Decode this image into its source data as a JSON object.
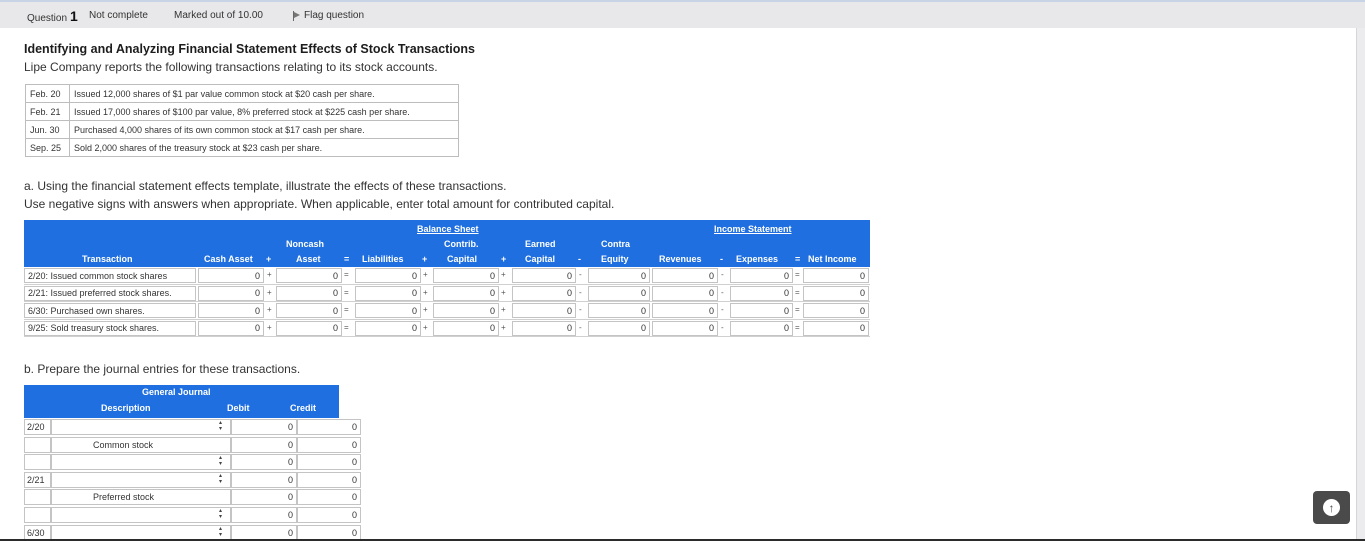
{
  "question_bar": {
    "label": "Question",
    "number": "1",
    "status": "Not complete",
    "marks": "Marked out of 10.00",
    "flag_label": "Flag question"
  },
  "title": "Identifying and Analyzing Financial Statement Effects of Stock Transactions",
  "intro": "Lipe Company reports the following transactions relating to its stock accounts.",
  "transactions": [
    {
      "date": "Feb. 20",
      "text": "Issued 12,000 shares of $1 par value common stock at $20 cash per share."
    },
    {
      "date": "Feb. 21",
      "text": "Issued 17,000 shares of $100 par value, 8% preferred stock at $225 cash per share."
    },
    {
      "date": "Jun. 30",
      "text": "Purchased 4,000 shares of its own common stock at $17 cash per share."
    },
    {
      "date": "Sep. 25",
      "text": "Sold 2,000 shares of the treasury stock at $23 cash per share."
    }
  ],
  "part_a": {
    "line1": "a. Using the financial statement effects template, illustrate the effects of these transactions.",
    "line2": "Use negative signs with answers when appropriate. When applicable, enter total amount for contributed capital."
  },
  "effects": {
    "group_balance": "Balance Sheet",
    "group_income": "Income Statement",
    "h_transaction": "Transaction",
    "h_cash": "Cash Asset",
    "h_noncash_1": "Noncash",
    "h_noncash_2": "Asset",
    "h_liabilities": "Liabilities",
    "h_contrib_1": "Contrib.",
    "h_contrib_2": "Capital",
    "h_earned_1": "Earned",
    "h_earned_2": "Capital",
    "h_contra_1": "Contra",
    "h_contra_2": "Equity",
    "h_revenues": "Revenues",
    "h_expenses": "Expenses",
    "h_net": "Net Income",
    "op_plus": "+",
    "op_eq": "=",
    "op_minus": "-",
    "rows": [
      {
        "label": "2/20: Issued common stock shares",
        "cash": "0",
        "noncash": "0",
        "liab": "0",
        "contrib": "0",
        "earned": "0",
        "contra": "0",
        "rev": "0",
        "exp": "0",
        "net": "0"
      },
      {
        "label": "2/21: Issued preferred stock shares.",
        "cash": "0",
        "noncash": "0",
        "liab": "0",
        "contrib": "0",
        "earned": "0",
        "contra": "0",
        "rev": "0",
        "exp": "0",
        "net": "0"
      },
      {
        "label": "6/30: Purchased own shares.",
        "cash": "0",
        "noncash": "0",
        "liab": "0",
        "contrib": "0",
        "earned": "0",
        "contra": "0",
        "rev": "0",
        "exp": "0",
        "net": "0"
      },
      {
        "label": "9/25: Sold treasury stock shares.",
        "cash": "0",
        "noncash": "0",
        "liab": "0",
        "contrib": "0",
        "earned": "0",
        "contra": "0",
        "rev": "0",
        "exp": "0",
        "net": "0"
      }
    ]
  },
  "part_b": "b. Prepare the journal entries for these transactions.",
  "journal": {
    "h_group": "General Journal",
    "h_description": "Description",
    "h_debit": "Debit",
    "h_credit": "Credit",
    "rows": [
      {
        "date": "2/20",
        "desc": "",
        "select": true,
        "debit": "0",
        "credit": "0"
      },
      {
        "date": "",
        "desc": "Common stock",
        "select": false,
        "debit": "0",
        "credit": "0"
      },
      {
        "date": "",
        "desc": "",
        "select": true,
        "debit": "0",
        "credit": "0"
      },
      {
        "date": "2/21",
        "desc": "",
        "select": true,
        "debit": "0",
        "credit": "0"
      },
      {
        "date": "",
        "desc": "Preferred stock",
        "select": false,
        "debit": "0",
        "credit": "0"
      },
      {
        "date": "",
        "desc": "",
        "select": true,
        "debit": "0",
        "credit": "0"
      },
      {
        "date": "6/30",
        "desc": "",
        "select": true,
        "debit": "0",
        "credit": "0"
      }
    ]
  },
  "scroll_top_icon": "arrow-up-circle-icon"
}
